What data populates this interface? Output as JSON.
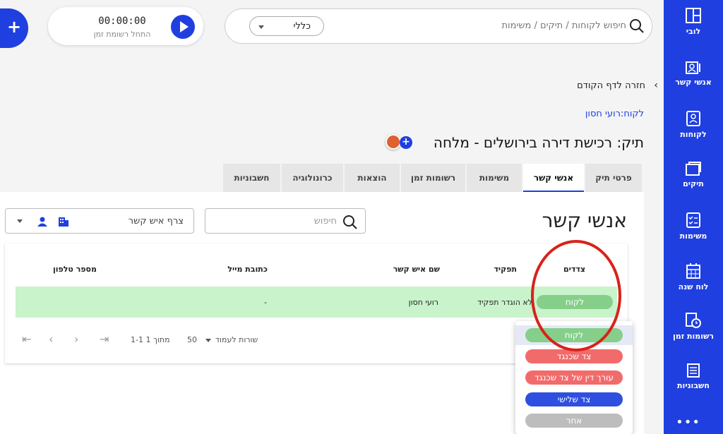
{
  "sidebar": {
    "items": [
      {
        "label": "לובי",
        "icon": "grid-icon"
      },
      {
        "label": "אנשי קשר",
        "icon": "contacts-icon"
      },
      {
        "label": "לקוחות",
        "icon": "client-icon"
      },
      {
        "label": "תיקים",
        "icon": "folder-icon"
      },
      {
        "label": "משימות",
        "icon": "tasks-icon"
      },
      {
        "label": "לוח שנה",
        "icon": "calendar-icon"
      },
      {
        "label": "רשומות זמן",
        "icon": "time-entries-icon"
      },
      {
        "label": "חשבוניות",
        "icon": "invoice-icon"
      }
    ],
    "more": "•••"
  },
  "topbar": {
    "timer_time": "00:00:00",
    "timer_label": "התחל רשומת זמן",
    "add_label": "+",
    "search_placeholder": "חיפוש לקוחות / תיקים / משימות",
    "scope_value": "כללי"
  },
  "header": {
    "back_label": "חזרה לדף הקודם",
    "client_link": "לקוח:רועי חסון",
    "case_title": "תיק: רכישת דירה בירושלים - מלחה"
  },
  "tabs": [
    {
      "label": "פרטי תיק",
      "active": false
    },
    {
      "label": "אנשי קשר",
      "active": true
    },
    {
      "label": "משימות",
      "active": false
    },
    {
      "label": "רשומות זמן",
      "active": false
    },
    {
      "label": "הוצאות",
      "active": false
    },
    {
      "label": "כרונולוגיה",
      "active": false
    },
    {
      "label": "חשבוניות",
      "active": false
    }
  ],
  "contacts": {
    "title": "אנשי קשר",
    "search_placeholder": "חיפוש",
    "add_contact_placeholder": "צרף איש קשר",
    "columns": [
      "צדדים",
      "תפקיד",
      "שם איש קשר",
      "כתובת מייל",
      "מספר טלפון"
    ],
    "rows": [
      {
        "party": "לקוח",
        "role": "לא הוגדר תפקיד",
        "name": "רועי חסון",
        "email": "-",
        "phone": ""
      }
    ],
    "pager": {
      "rows_per_page_label": "שורות לעמוד",
      "rows_per_page": "50",
      "range": "1-1 מתוך 1"
    }
  },
  "party_options": [
    {
      "label": "לקוח",
      "color": "#86cf8a"
    },
    {
      "label": "צד שכנגד",
      "color": "#f26b6b"
    },
    {
      "label": "עורך דין של צד שכנגד",
      "color": "#f26b6b"
    },
    {
      "label": "צד שלישי",
      "color": "#2f4fe0"
    },
    {
      "label": "אחר",
      "color": "#bdbdbd"
    }
  ],
  "colors": {
    "accent": "#1f3fe0",
    "row_highlight": "#c9f3cb",
    "annotation": "#d8221b"
  }
}
